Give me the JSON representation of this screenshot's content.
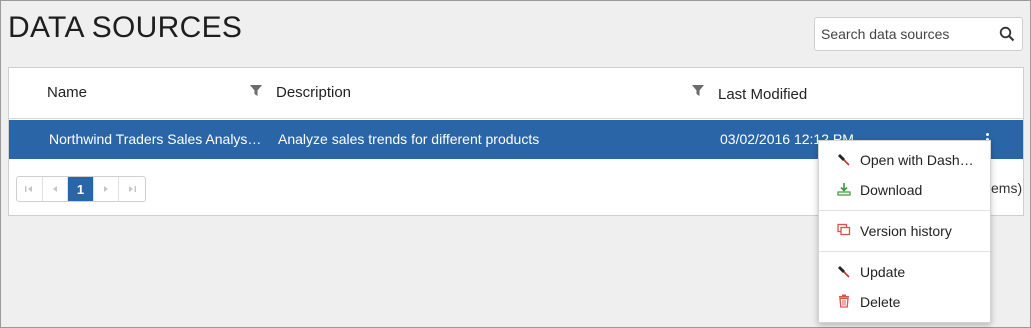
{
  "page": {
    "title": "DATA SOURCES"
  },
  "search": {
    "placeholder": "Search data sources",
    "icon": "search-icon"
  },
  "grid": {
    "columns": [
      {
        "label": "Name",
        "filterable": true
      },
      {
        "label": "Description",
        "filterable": true
      },
      {
        "label": "Last Modified",
        "filterable": false
      }
    ],
    "rows": [
      {
        "name": "Northwind Traders Sales Analys…",
        "description": "Analyze sales trends for different products",
        "last_modified": "03/02/2016 12:12 PM",
        "selected": true
      }
    ],
    "pager": {
      "current_page": "1",
      "buttons": [
        "first-page-icon",
        "prev-page-icon",
        "next-page-icon",
        "last-page-icon"
      ]
    },
    "items_text": "ems)"
  },
  "context_menu": {
    "items": [
      {
        "label": "Open with Dash…",
        "icon": "dashboard-pin-icon"
      },
      {
        "label": "Download",
        "icon": "download-icon"
      },
      {
        "label": "Version history",
        "icon": "version-history-icon"
      },
      {
        "label": "Update",
        "icon": "update-pin-icon"
      },
      {
        "label": "Delete",
        "icon": "trash-icon"
      }
    ]
  },
  "colors": {
    "accent": "#2a65a8",
    "selected_row": "#2a65a8",
    "download_icon": "#3a9a3a",
    "history_icon": "#d9534f",
    "delete_icon": "#d9534f"
  }
}
